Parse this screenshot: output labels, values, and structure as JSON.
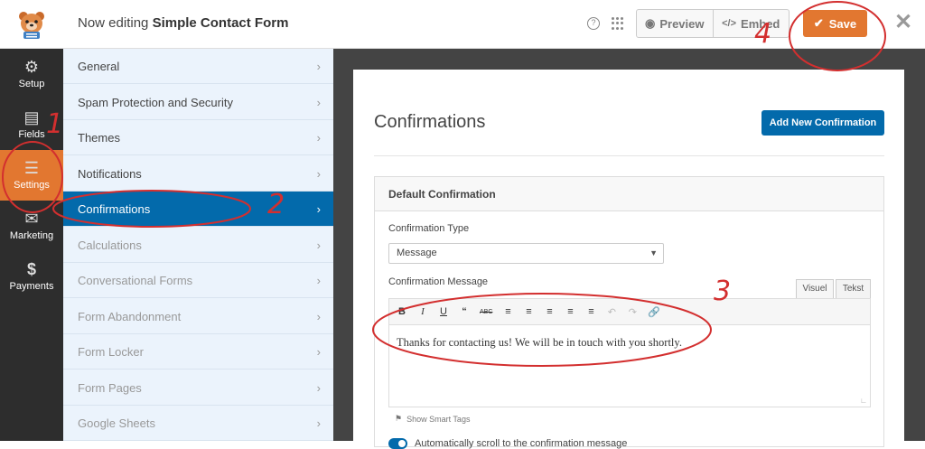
{
  "header": {
    "editing_prefix": "Now editing",
    "form_name": "Simple Contact Form",
    "preview_label": "Preview",
    "embed_label": "Embed",
    "save_label": "Save"
  },
  "sidebar": {
    "items": [
      {
        "label": "Setup",
        "icon": "gear-icon"
      },
      {
        "label": "Fields",
        "icon": "list-icon"
      },
      {
        "label": "Settings",
        "icon": "sliders-icon"
      },
      {
        "label": "Marketing",
        "icon": "megaphone-icon"
      },
      {
        "label": "Payments",
        "icon": "dollar-icon"
      }
    ],
    "active": "Settings"
  },
  "settings_menu": {
    "items": [
      {
        "label": "General"
      },
      {
        "label": "Spam Protection and Security"
      },
      {
        "label": "Themes"
      },
      {
        "label": "Notifications"
      },
      {
        "label": "Confirmations"
      },
      {
        "label": "Calculations"
      },
      {
        "label": "Conversational Forms"
      },
      {
        "label": "Form Abandonment"
      },
      {
        "label": "Form Locker"
      },
      {
        "label": "Form Pages"
      },
      {
        "label": "Google Sheets"
      }
    ],
    "active": "Confirmations"
  },
  "main": {
    "title": "Confirmations",
    "add_button": "Add New Confirmation",
    "box_title": "Default Confirmation",
    "type_label": "Confirmation Type",
    "type_value": "Message",
    "message_label": "Confirmation Message",
    "tab_visual": "Visuel",
    "tab_text": "Tekst",
    "message_text": "Thanks for contacting us! We will be in touch with you shortly.",
    "smart_tags": "Show Smart Tags",
    "toggle_label": "Automatically scroll to the confirmation message",
    "toggle_on": true
  },
  "annotations": [
    "1",
    "2",
    "3",
    "4"
  ],
  "colors": {
    "accent_orange": "#e27730",
    "accent_blue": "#036aab",
    "sidebar_bg": "#2d2d2d",
    "menu_bg": "#ebf3fc",
    "annotation_red": "#d32f2f"
  }
}
